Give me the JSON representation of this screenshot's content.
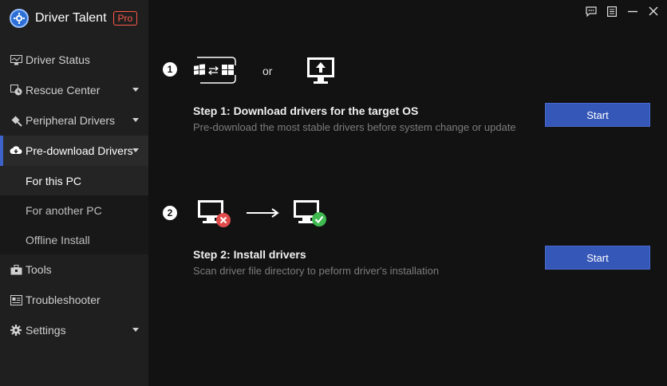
{
  "app": {
    "title": "Driver Talent",
    "badge": "Pro"
  },
  "sidebar": {
    "items": [
      {
        "label": "Driver Status"
      },
      {
        "label": "Rescue Center"
      },
      {
        "label": "Peripheral Drivers"
      },
      {
        "label": "Pre-download Drivers"
      },
      {
        "label": "Tools"
      },
      {
        "label": "Troubleshooter"
      },
      {
        "label": "Settings"
      }
    ],
    "subitems": [
      {
        "label": "For this PC"
      },
      {
        "label": "For another PC"
      },
      {
        "label": "Offline Install"
      }
    ]
  },
  "window_controls": [
    "chat-icon",
    "menu-icon",
    "minimize-icon",
    "close-icon"
  ],
  "main": {
    "step1": {
      "number": "1",
      "or_text": "or",
      "title": "Step 1: Download drivers for the target OS",
      "desc": "Pre-download the most stable drivers before system change or update",
      "button": "Start"
    },
    "step2": {
      "number": "2",
      "title": "Step 2: Install drivers",
      "desc": "Scan driver file directory to peform driver's installation",
      "button": "Start"
    }
  },
  "colors": {
    "accent": "#3d62c9",
    "button": "#3557b8",
    "badge": "#ff5a4a",
    "error": "#e04b4b",
    "success": "#3fb950"
  }
}
